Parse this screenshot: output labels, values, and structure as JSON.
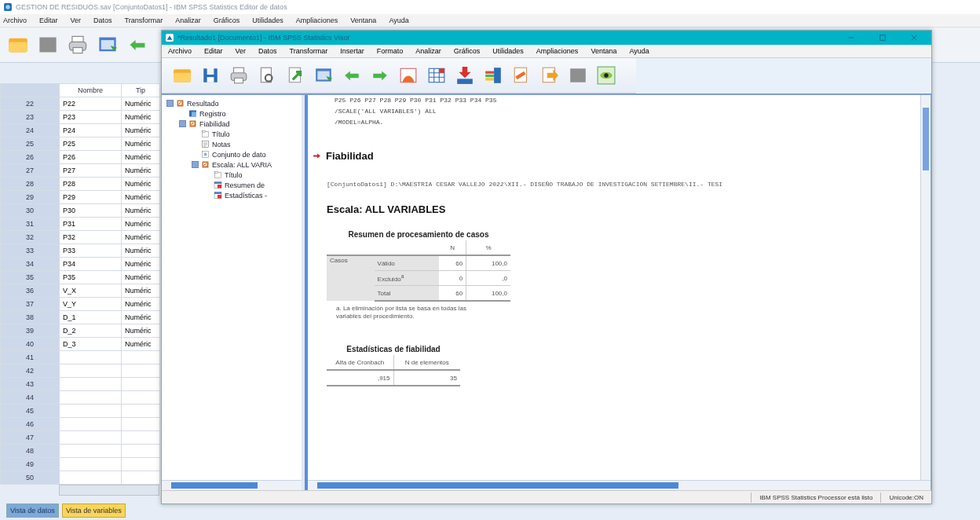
{
  "data_editor": {
    "title": "GESTION DE RESIDUOS.sav [ConjuntoDatos1] - IBM SPSS Statistics Editor de datos",
    "menu": [
      "Archivo",
      "Editar",
      "Ver",
      "Datos",
      "Transformar",
      "Analizar",
      "Gráficos",
      "Utilidades",
      "Ampliaciones",
      "Ventana",
      "Ayuda"
    ],
    "columns": [
      "Nombre",
      "Tip"
    ],
    "rows": [
      {
        "number": "22",
        "name": "P22",
        "type": "Numéric"
      },
      {
        "number": "23",
        "name": "P23",
        "type": "Numéric"
      },
      {
        "number": "24",
        "name": "P24",
        "type": "Numéric"
      },
      {
        "number": "25",
        "name": "P25",
        "type": "Numéric"
      },
      {
        "number": "26",
        "name": "P26",
        "type": "Numéric"
      },
      {
        "number": "27",
        "name": "P27",
        "type": "Numéric"
      },
      {
        "number": "28",
        "name": "P28",
        "type": "Numéric"
      },
      {
        "number": "29",
        "name": "P29",
        "type": "Numéric"
      },
      {
        "number": "30",
        "name": "P30",
        "type": "Numéric"
      },
      {
        "number": "31",
        "name": "P31",
        "type": "Numéric"
      },
      {
        "number": "32",
        "name": "P32",
        "type": "Numéric"
      },
      {
        "number": "33",
        "name": "P33",
        "type": "Numéric"
      },
      {
        "number": "34",
        "name": "P34",
        "type": "Numéric"
      },
      {
        "number": "35",
        "name": "P35",
        "type": "Numéric"
      },
      {
        "number": "36",
        "name": "V_X",
        "type": "Numéric"
      },
      {
        "number": "37",
        "name": "V_Y",
        "type": "Numéric"
      },
      {
        "number": "38",
        "name": "D_1",
        "type": "Numéric"
      },
      {
        "number": "39",
        "name": "D_2",
        "type": "Numéric"
      },
      {
        "number": "40",
        "name": "D_3",
        "type": "Numéric"
      },
      {
        "number": "41"
      },
      {
        "number": "42"
      },
      {
        "number": "43"
      },
      {
        "number": "44"
      },
      {
        "number": "45"
      },
      {
        "number": "46"
      },
      {
        "number": "47"
      },
      {
        "number": "48"
      },
      {
        "number": "49"
      },
      {
        "number": "50"
      }
    ],
    "tabs": [
      {
        "label": "Vista de datos",
        "selected": false
      },
      {
        "label": "Vista de variables",
        "selected": true
      }
    ]
  },
  "viewer": {
    "title": "*Resultado1 [Documento1] - IBM SPSS Statistics Visor",
    "menu": [
      "Archivo",
      "Editar",
      "Ver",
      "Datos",
      "Transformar",
      "Insertar",
      "Formato",
      "Analizar",
      "Gráficos",
      "Utilidades",
      "Ampliaciones",
      "Ventana",
      "Ayuda"
    ],
    "outline": [
      {
        "label": "Resultado",
        "kind": "heading",
        "children": [
          {
            "label": "Registro",
            "kind": "log"
          },
          {
            "label": "Fiabilidad",
            "kind": "heading",
            "children": [
              {
                "label": "Título",
                "kind": "title"
              },
              {
                "label": "Notas",
                "kind": "notes"
              },
              {
                "label": "Conjunto de dato",
                "kind": "dataset"
              },
              {
                "label": "Escala: ALL VARIA",
                "kind": "heading",
                "children": [
                  {
                    "label": "Título",
                    "kind": "title"
                  },
                  {
                    "label": "Resumen de",
                    "kind": "table"
                  },
                  {
                    "label": "Estadísticas -",
                    "kind": "table"
                  }
                ]
              }
            ]
          }
        ]
      }
    ],
    "syntax": [
      "P25 P26 P27 P28 P29 P30 P31 P32 P33 P34 P35",
      "/SCALE('ALL VARIABLES') ALL",
      "/MODEL=ALPHA."
    ],
    "heading": "Fiabilidad",
    "dataset_line": "[ConjuntoDatos1] D:\\MAESTRIA CESAR VALLEJO 2022\\XII.- DISEÑO TRABAJO DE INVESTIGACION SETIEMBRE\\II.- TESI",
    "subheading": "Escala: ALL VARIABLES",
    "case_summary": {
      "title": "Resumen de procesamiento de casos",
      "columns": [
        "N",
        "%"
      ],
      "group": "Casos",
      "rows": [
        {
          "label": "Válido",
          "n": "60",
          "pct": "100,0"
        },
        {
          "label": "Excluido$^{a}$",
          "n": "0",
          "pct": ",0"
        },
        {
          "label": "Total",
          "n": "60",
          "pct": "100,0"
        }
      ],
      "footnote": "a. La eliminación por lista se basa en todas las variables del procedimiento."
    },
    "reliability": {
      "title": "Estadísticas de fiabilidad",
      "columns": [
        "Alfa de Cronbach",
        "N de elementos"
      ],
      "values": [
        ",915",
        "35"
      ]
    },
    "status": [
      "IBM SPSS Statistics Processor está listo",
      "Unicode:ON"
    ]
  }
}
